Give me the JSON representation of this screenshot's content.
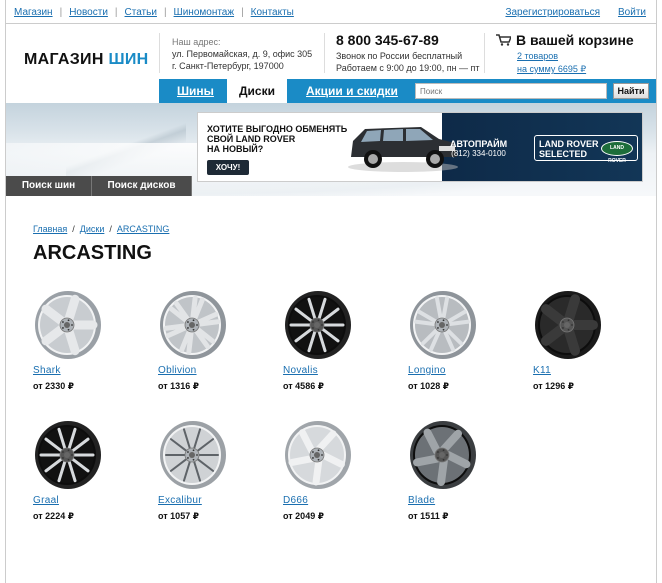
{
  "topnav": [
    "Магазин",
    "Новости",
    "Статьи",
    "Шиномонтаж",
    "Контакты"
  ],
  "account": {
    "register": "Зарегистрироваться",
    "login": "Войти"
  },
  "logo": {
    "part1": "МАГАЗИН",
    "part2": "ШИН"
  },
  "address": {
    "label": "Наш адрес:",
    "line1": "ул. Первомайская, д. 9, офис 305",
    "line2": "г. Санкт-Петербург, 197000"
  },
  "phone": {
    "number": "8 800 345-67-89",
    "line1": "Звонок по России бесплатный",
    "line2": "Работаем с 9:00 до 19:00, пн — пт"
  },
  "cart": {
    "title": "В вашей корзине",
    "items": "2 товаров",
    "sum": "на сумму 6695 ₽"
  },
  "nav": {
    "tabs": [
      "Шины",
      "Диски",
      "Акции и скидки"
    ],
    "active": "Диски"
  },
  "search": {
    "placeholder": "Поиск",
    "button": "Найти"
  },
  "banner": {
    "ad_text_1": "Хотите выгодно обменять",
    "ad_text_2": "свой Land Rover",
    "ad_text_3": "на новый?",
    "ad_button": "ХОЧУ!",
    "dealer": "АВТОПРАЙМ",
    "dealer_phone": "(812) 334-0100",
    "brand_1": "LAND ROVER",
    "brand_2": "SELECTED",
    "oval": "LAND ROVER"
  },
  "search_buttons": [
    "Поиск шин",
    "Поиск дисков"
  ],
  "breadcrumb": [
    "Главная",
    "Диски",
    "ARCASTING"
  ],
  "page_title": "ARCASTING",
  "products": [
    {
      "name": "Shark",
      "price": "от 2330 ₽",
      "style": "five-spoke"
    },
    {
      "name": "Oblivion",
      "price": "от 1316 ₽",
      "style": "multi-spoke"
    },
    {
      "name": "Novalis",
      "price": "от 4586 ₽",
      "style": "black-polished"
    },
    {
      "name": "Longino",
      "price": "от 1028 ₽",
      "style": "split-spoke"
    },
    {
      "name": "K11",
      "price": "от 1296 ₽",
      "style": "black"
    },
    {
      "name": "Graal",
      "price": "от 2224 ₽",
      "style": "black-polished"
    },
    {
      "name": "Excalibur",
      "price": "от 1057 ₽",
      "style": "thin-spoke"
    },
    {
      "name": "D666",
      "price": "от 2049 ₽",
      "style": "twisted"
    },
    {
      "name": "Blade",
      "price": "от 1511 ₽",
      "style": "dark-five"
    }
  ],
  "colors": {
    "accent": "#1a8bc6",
    "link": "#1a6fb0",
    "dark_button": "#4b4b4b"
  }
}
